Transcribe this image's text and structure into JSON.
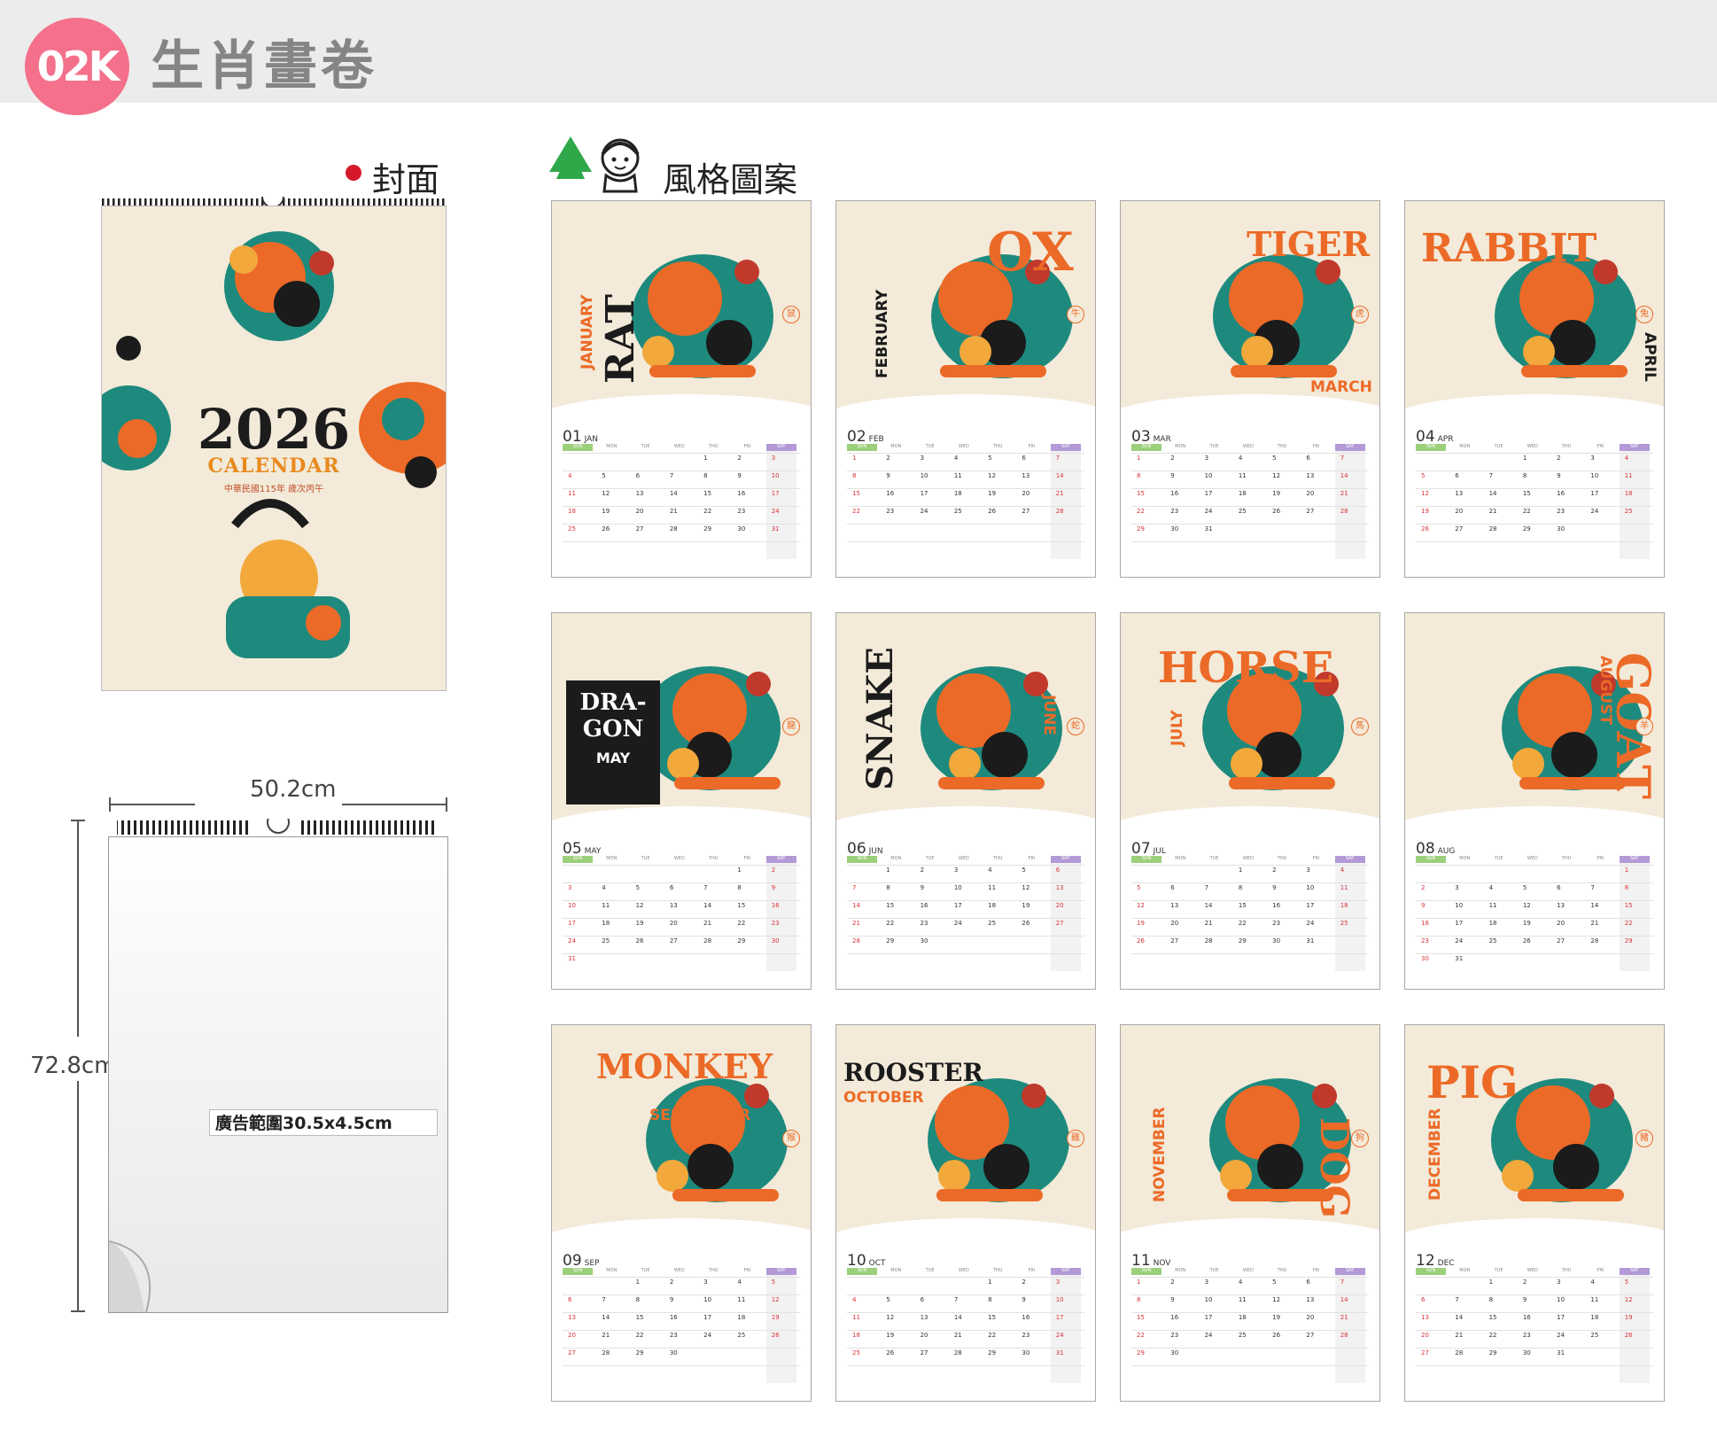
{
  "header": {
    "badge": "02K",
    "title": "生肖畫卷"
  },
  "cover_section": {
    "label": "封面"
  },
  "style_section": {
    "label": "風格圖案"
  },
  "cover": {
    "year": "2026",
    "calendar": "CALENDAR",
    "subtitle": "中華民國115年 歲次丙午"
  },
  "size": {
    "width": "50.2cm",
    "height": "72.8cm",
    "ad_area": "廣告範圍30.5x4.5cm"
  },
  "weekdays": [
    "SUN",
    "MON",
    "TUE",
    "WED",
    "THU",
    "FRI",
    "SAT"
  ],
  "colors": {
    "orange": "#ec6a27",
    "teal": "#1e8a7e",
    "cream": "#f3ead9",
    "black": "#1b1b1b",
    "pink": "#f4708b"
  },
  "months": [
    {
      "num": "01",
      "abbr": "JAN",
      "animal": "RAT",
      "month": "JANUARY",
      "char": "鼠",
      "start": 4,
      "days": 31
    },
    {
      "num": "02",
      "abbr": "FEB",
      "animal": "OX",
      "month": "FEBRUARY",
      "char": "牛",
      "start": 0,
      "days": 28
    },
    {
      "num": "03",
      "abbr": "MAR",
      "animal": "TIGER",
      "month": "MARCH",
      "char": "虎",
      "start": 0,
      "days": 31
    },
    {
      "num": "04",
      "abbr": "APR",
      "animal": "RABBIT",
      "month": "APRIL",
      "char": "兔",
      "start": 3,
      "days": 30
    },
    {
      "num": "05",
      "abbr": "MAY",
      "animal": "DRA-GON",
      "month": "MAY",
      "char": "龍",
      "start": 5,
      "days": 31
    },
    {
      "num": "06",
      "abbr": "JUN",
      "animal": "SNAKE",
      "month": "JUNE",
      "char": "蛇",
      "start": 1,
      "days": 30
    },
    {
      "num": "07",
      "abbr": "JUL",
      "animal": "HORSE",
      "month": "JULY",
      "char": "馬",
      "start": 3,
      "days": 31
    },
    {
      "num": "08",
      "abbr": "AUG",
      "animal": "GOAT",
      "month": "AUGUST",
      "char": "羊",
      "start": 6,
      "days": 31
    },
    {
      "num": "09",
      "abbr": "SEP",
      "animal": "MONKEY",
      "month": "SEPTEMBER",
      "char": "猴",
      "start": 2,
      "days": 30
    },
    {
      "num": "10",
      "abbr": "OCT",
      "animal": "ROOSTER",
      "month": "OCTOBER",
      "char": "雞",
      "start": 4,
      "days": 31
    },
    {
      "num": "11",
      "abbr": "NOV",
      "animal": "DOG",
      "month": "NOVEMBER",
      "char": "狗",
      "start": 0,
      "days": 30
    },
    {
      "num": "12",
      "abbr": "DEC",
      "animal": "PIG",
      "month": "DECEMBER",
      "char": "豬",
      "start": 2,
      "days": 31
    }
  ]
}
